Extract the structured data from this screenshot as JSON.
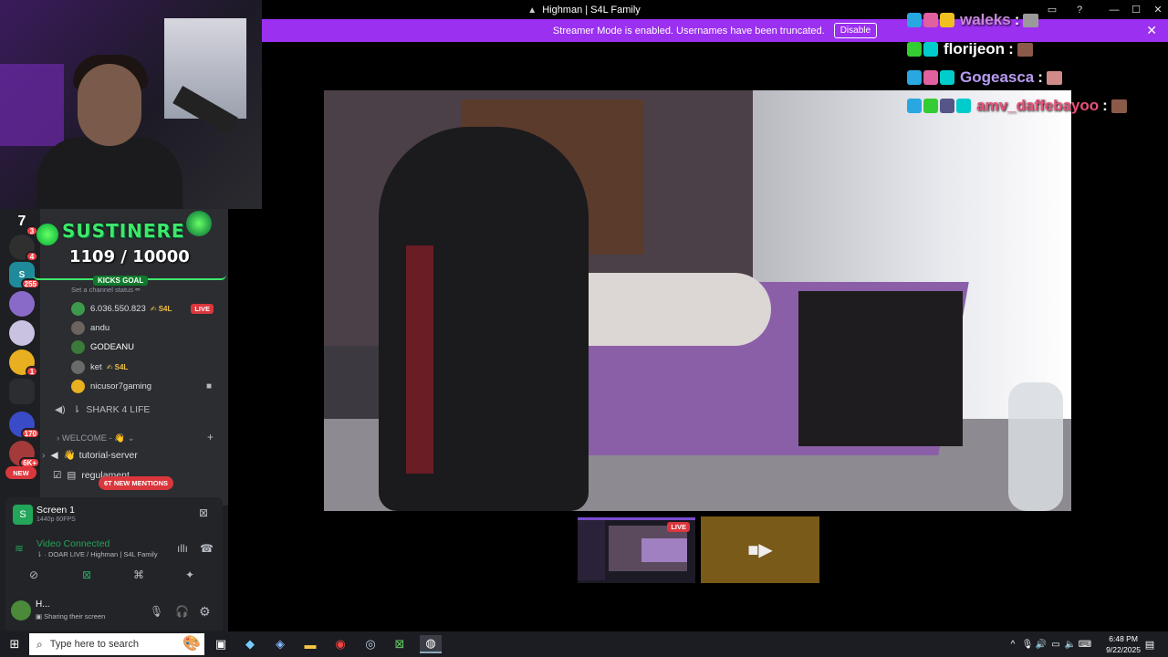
{
  "window": {
    "title": "Highman | S4L Family"
  },
  "streamer_mode": {
    "message": "Streamer Mode is enabled. Usernames have been truncated.",
    "button": "Disable"
  },
  "chat_overlay": [
    {
      "user": "waleks",
      "color": "#c98ad8"
    },
    {
      "user": "florijeon",
      "color": "#ffffff"
    },
    {
      "user": "Gogeasca",
      "color": "#b79cf0"
    },
    {
      "user": "amv_daffebayoo",
      "color": "#e8507a"
    }
  ],
  "goal": {
    "title": "SUSTINERE",
    "count": "1109  / 10000",
    "label": "KICKS GOAL"
  },
  "servers": [
    {
      "label": "7",
      "badge": "3"
    },
    {
      "label": "",
      "badge": "4"
    },
    {
      "label": "S",
      "badge": "255"
    },
    {
      "label": "",
      "badge": ""
    },
    {
      "label": "",
      "badge": ""
    },
    {
      "label": "",
      "badge": "1"
    },
    {
      "label": "",
      "badge": ""
    },
    {
      "label": "",
      "badge": "170"
    },
    {
      "label": "",
      "badge": "6K+"
    },
    {
      "label": "NEW",
      "badge": ""
    }
  ],
  "channel_status": "Set a channel status ✏",
  "voice_members": [
    {
      "name": "6.036.550.823",
      "tag": "✍ S4L",
      "live": "LIVE"
    },
    {
      "name": "andu",
      "tag": "",
      "live": ""
    },
    {
      "name": "GODEANU",
      "tag": "",
      "live": ""
    },
    {
      "name": "ket",
      "tag": "✍ S4L",
      "live": ""
    },
    {
      "name": "nicusor7gaming",
      "tag": "",
      "live": ""
    }
  ],
  "channels": {
    "voice": "SHARK 4 LIFE",
    "category": "WELCOME - 👋",
    "items": [
      "tutorial-server",
      "regulament"
    ],
    "mentions": "6T NEW MENTIONS"
  },
  "screen_share": {
    "title": "Screen 1",
    "quality": "1440p 60FPS"
  },
  "voice": {
    "status": "Video Connected",
    "channel": "DOAR LIVE / Highman | S4L Family"
  },
  "user": {
    "name": "H...",
    "status": "Sharing their screen"
  },
  "thumbnail": {
    "live": "LIVE"
  },
  "taskbar": {
    "search_placeholder": "Type here to search",
    "time": "6:48 PM",
    "date": "9/22/2025"
  }
}
